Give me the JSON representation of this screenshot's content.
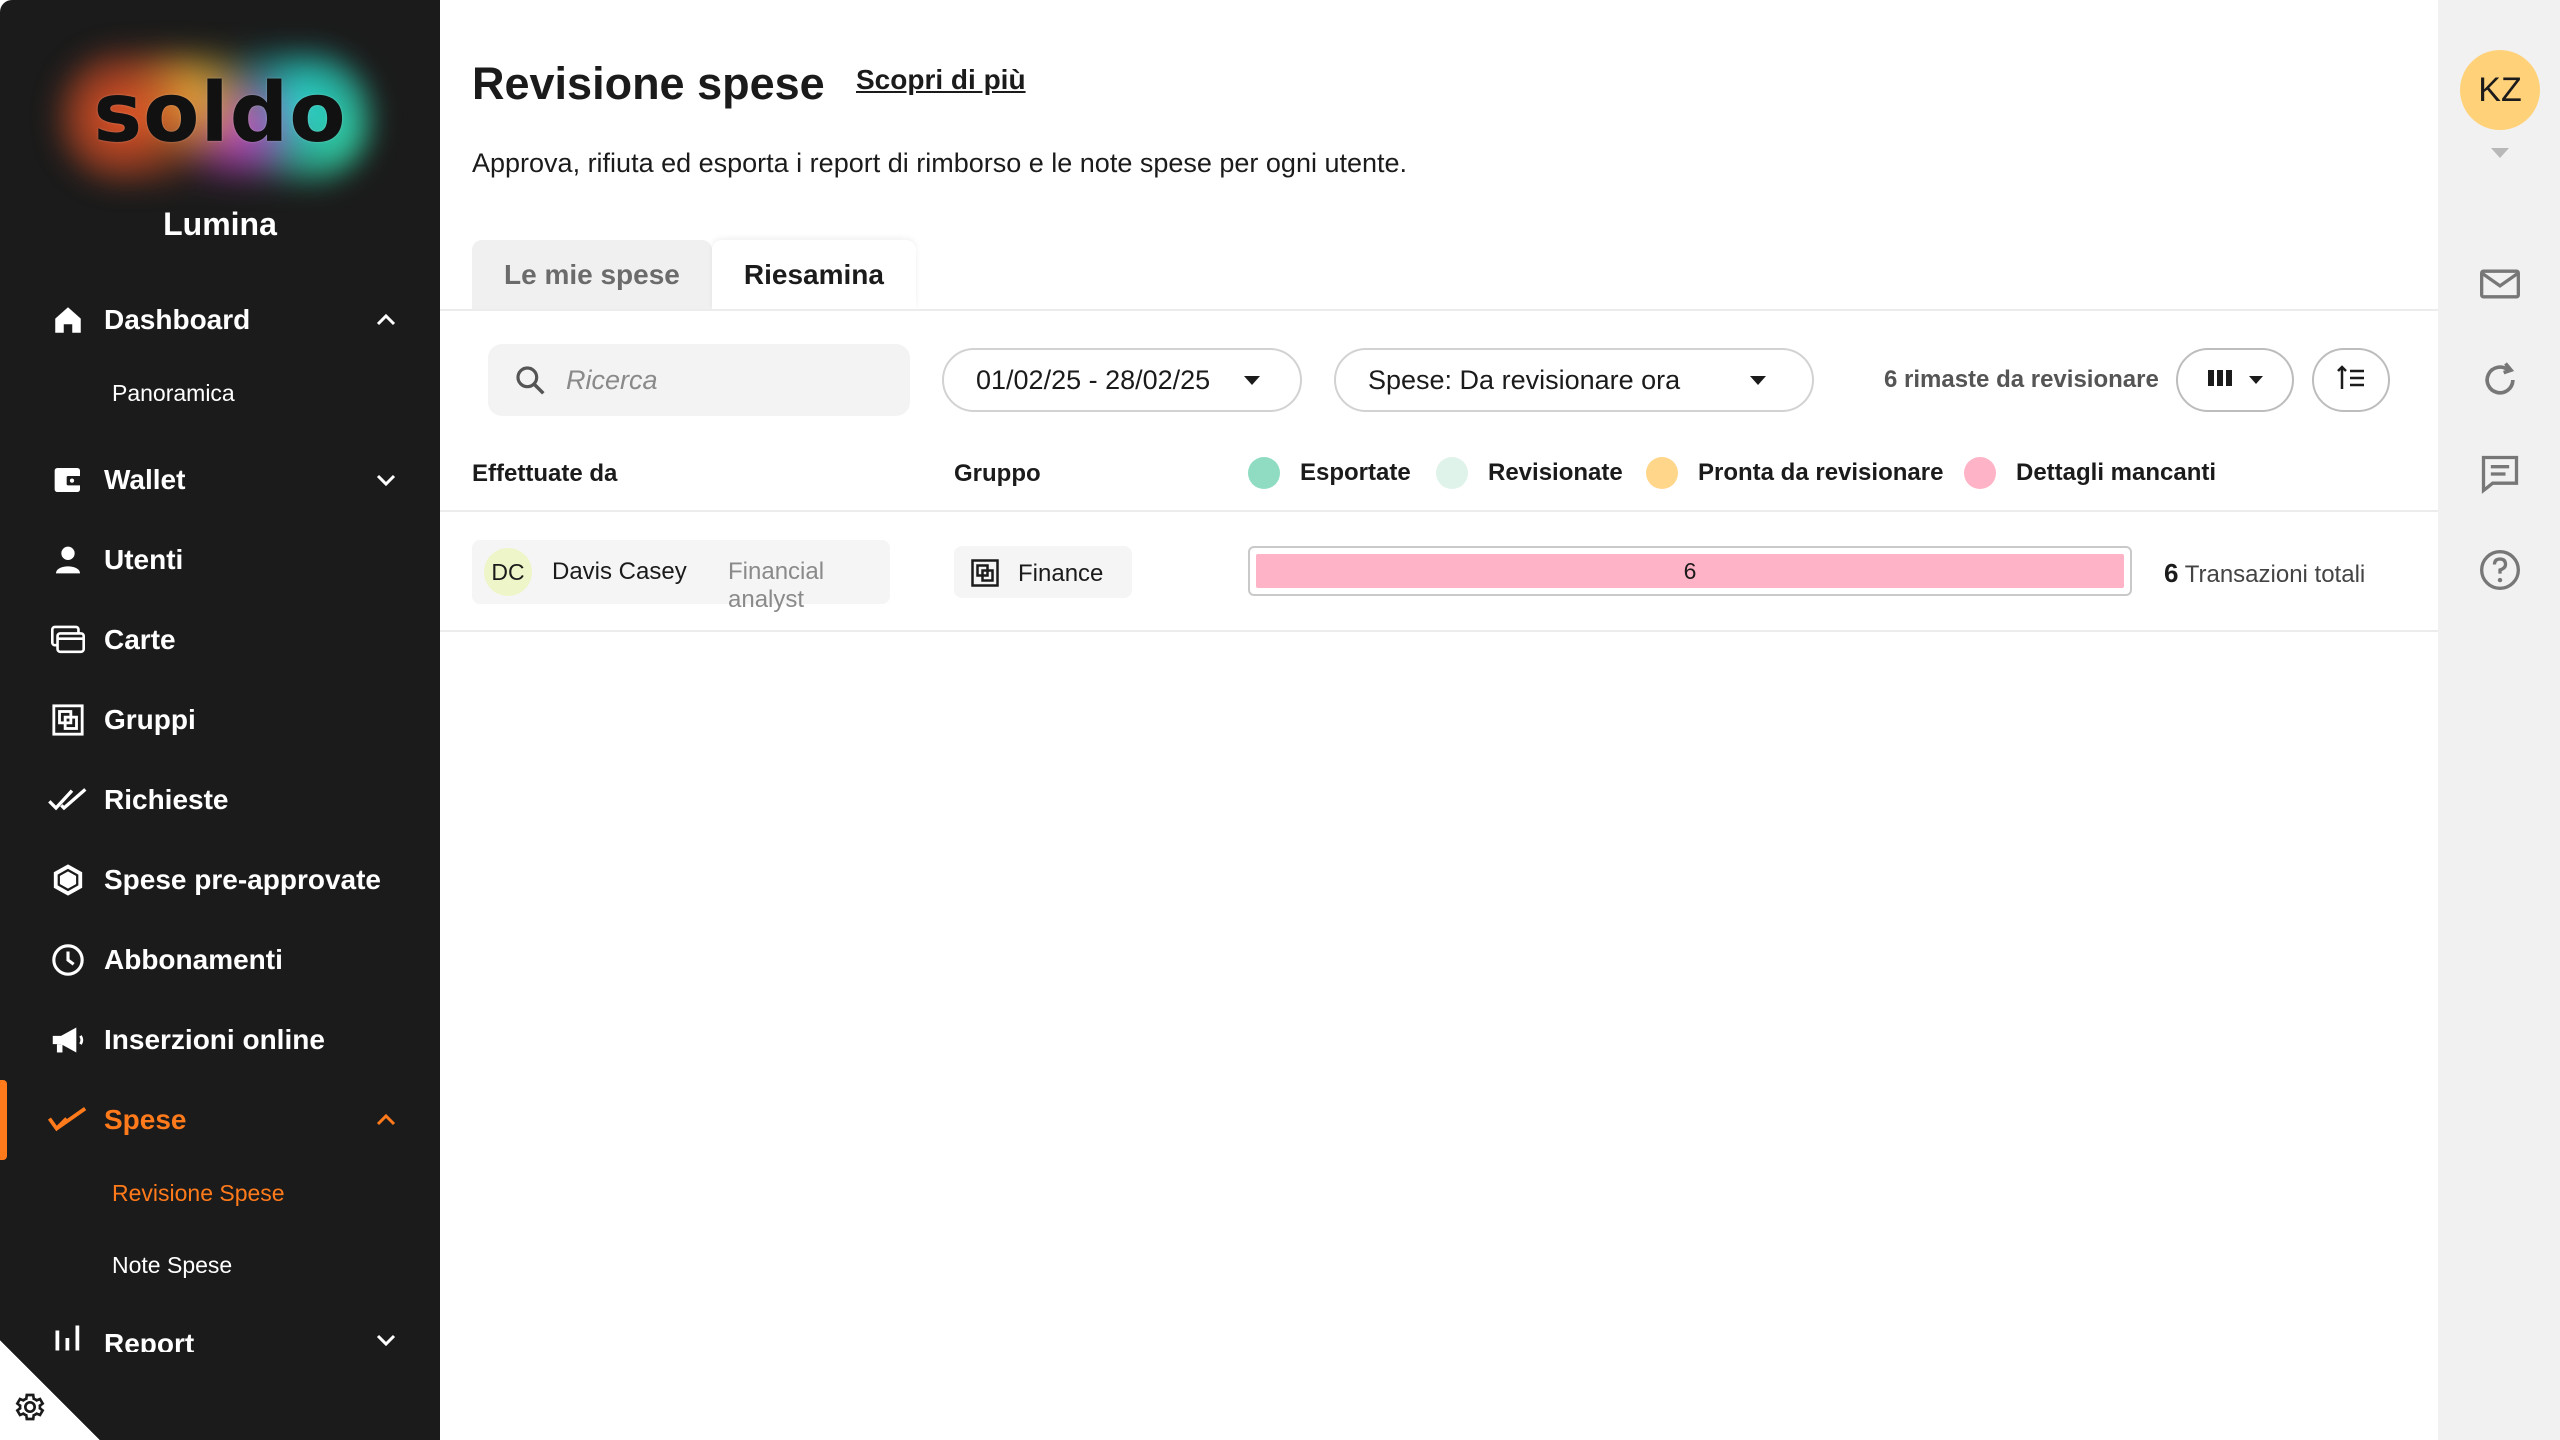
{
  "sidebar": {
    "logo_text": "soldo",
    "org_name": "Lumina",
    "nav": {
      "dashboard": "Dashboard",
      "panoramica": "Panoramica",
      "wallet": "Wallet",
      "utenti": "Utenti",
      "carte": "Carte",
      "gruppi": "Gruppi",
      "richieste": "Richieste",
      "pre_approvate": "Spese pre-approvate",
      "abbonamenti": "Abbonamenti",
      "inserzioni": "Inserzioni online",
      "spese": "Spese",
      "revisione_spese": "Revisione Spese",
      "note_spese": "Note Spese",
      "report": "Report"
    },
    "accent_color": "#ff7a1a"
  },
  "page": {
    "title": "Revisione spese",
    "learn_more": "Scopri di più",
    "subtitle": "Approva, rifiuta ed esporta i report di rimborso e le note spese per ogni utente."
  },
  "tabs": [
    "Le mie spese",
    "Riesamina"
  ],
  "active_tab": "Riesamina",
  "filters": {
    "search_placeholder": "Ricerca",
    "date_range": "01/02/25 - 28/02/25",
    "status_filter": "Spese: Da revisionare ora",
    "remaining": "6 rimaste da revisionare"
  },
  "table": {
    "col_user": "Effettuate da",
    "col_group": "Gruppo",
    "legend": [
      {
        "label": "Esportate",
        "color": "#8fdcc2"
      },
      {
        "label": "Revisionate",
        "color": "#dff3ea"
      },
      {
        "label": "Pronta da revisionare",
        "color": "#ffd68a"
      },
      {
        "label": "Dettagli mancanti",
        "color": "#ffb3c6"
      }
    ],
    "rows": [
      {
        "initials": "DC",
        "name": "Davis Casey",
        "role": "Financial analyst",
        "group": "Finance",
        "bar_value": "6",
        "bar_fraction": 1.0,
        "total_count": "6",
        "total_label": "Transazioni totali"
      }
    ]
  },
  "rail": {
    "user_initials": "KZ",
    "icons": [
      "mail-icon",
      "refresh-icon",
      "chat-icon",
      "help-icon"
    ]
  }
}
